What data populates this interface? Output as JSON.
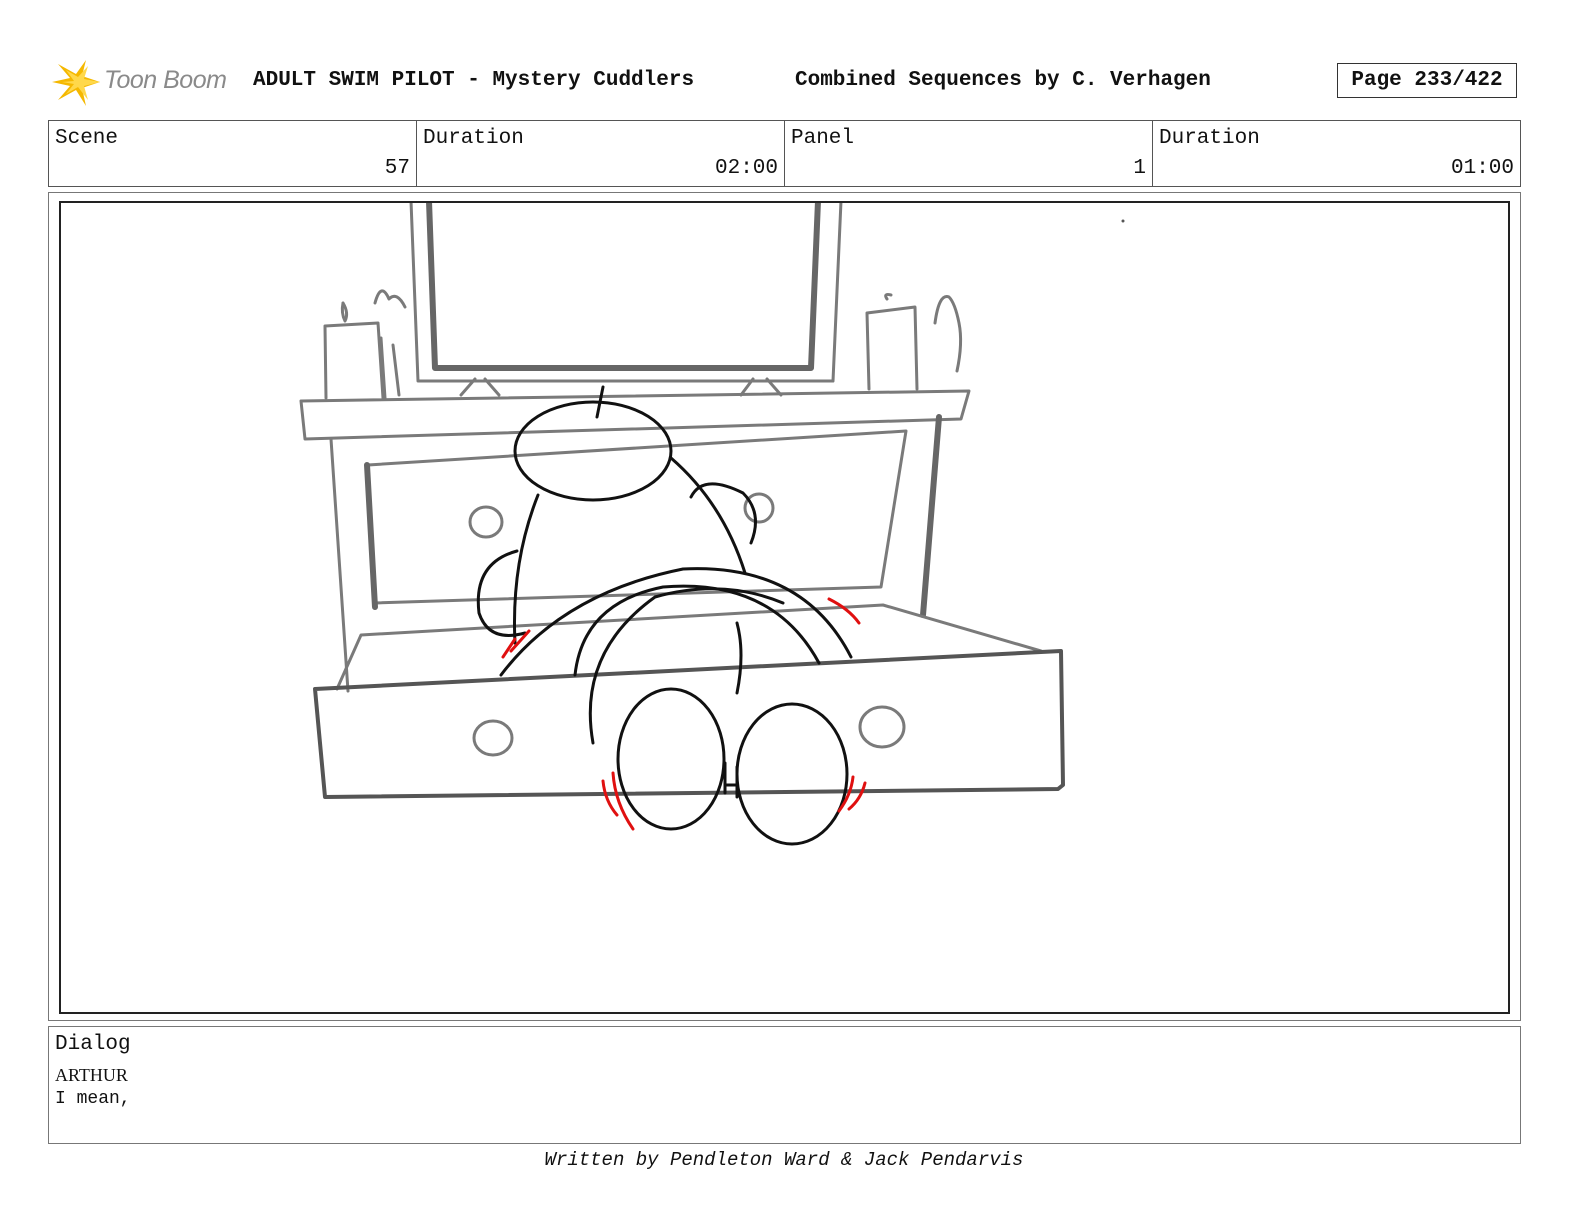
{
  "header": {
    "logo_text": "Toon Boom",
    "title": "ADULT SWIM PILOT - Mystery Cuddlers",
    "subtitle": "Combined Sequences by C. Verhagen",
    "page_label": "Page 233/422"
  },
  "info": {
    "scene_label": "Scene",
    "scene_value": "57",
    "scene_duration_label": "Duration",
    "scene_duration_value": "02:00",
    "panel_label": "Panel",
    "panel_value": "1",
    "panel_duration_label": "Duration",
    "panel_duration_value": "01:00"
  },
  "dialog": {
    "label": "Dialog",
    "speaker": "ARTHUR",
    "line": "I mean,"
  },
  "footer": {
    "credit": "Written by Pendleton Ward & Jack Pendarvis"
  },
  "colors": {
    "logo_yellow": "#f5b800",
    "sketch_gray": "#7a7a7a",
    "sketch_black": "#111111",
    "motion_red": "#e01010"
  }
}
